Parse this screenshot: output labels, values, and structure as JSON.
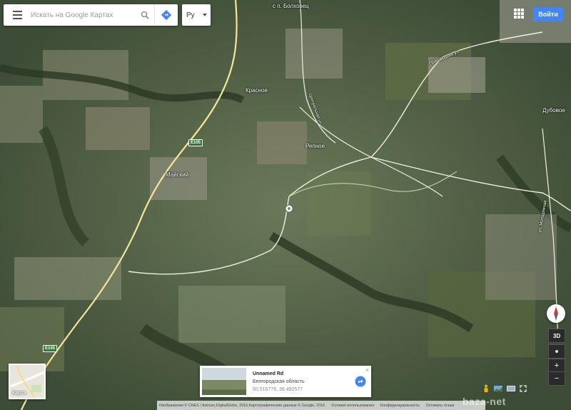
{
  "search": {
    "placeholder": "Искать на Google Картах"
  },
  "language": {
    "selected": "Ру"
  },
  "header": {
    "sign_in": "Войти"
  },
  "icons": {
    "menu": "menu-icon",
    "search": "search-icon",
    "directions": "directions-icon",
    "apps": "apps-grid-icon",
    "compass": "compass-icon",
    "location": "my-location-icon",
    "pegman": "pegman-icon"
  },
  "map_labels": {
    "bolkhovets": "с п. Болховец",
    "krasnoe": "Красное",
    "repnoe": "Репное",
    "mayskiy": "Майский",
    "dubovoe": "Дубовое",
    "prigorodnaya": "Пригородная ул.",
    "tsentralnaya": "Центральная ул.",
    "molodyozhnaya": "ул. Молодёжная",
    "e105_top": "E105",
    "e105_bottom": "E105"
  },
  "minimap": {
    "label": "Карта"
  },
  "place_card": {
    "title": "Unnamed Rd",
    "region": "Белгородская область",
    "coordinates": "50.516776, 36.492577",
    "close": "×"
  },
  "controls": {
    "three_d": "3D",
    "zoom_in": "+",
    "zoom_out": "−"
  },
  "attribution": {
    "imagery": "Изображения © CNES / Astrium,DigitalGlobe, 2016,Картографические данные © Google, 2016",
    "terms": "Условия использования",
    "privacy": "Конфиденциальность",
    "feedback": "Оставить отзыв"
  },
  "watermark": "baza-net",
  "colors": {
    "accent": "#4285f4",
    "road": "#f2eedf",
    "highway": "#f6e69a"
  }
}
